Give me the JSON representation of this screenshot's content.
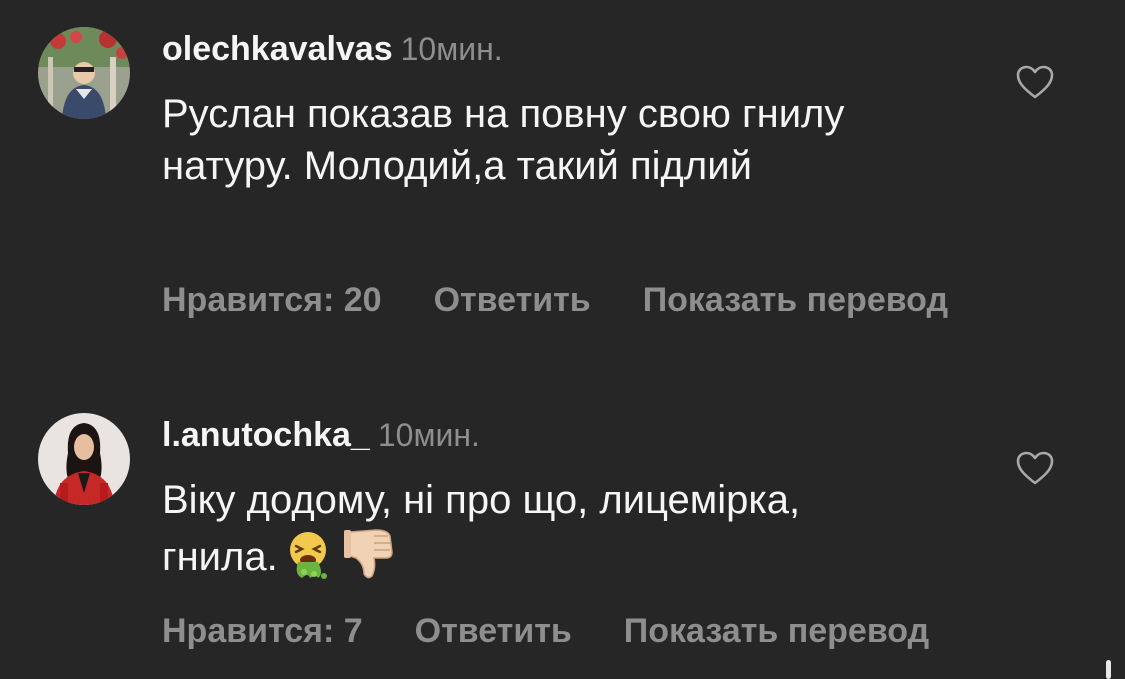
{
  "comments": [
    {
      "username": "olechkavalvas",
      "time": "10мин.",
      "text": "Руслан показав на повну свою гнилу натуру. Молодий,а такий підлий",
      "likes_label": "Нравится: 20",
      "reply_label": "Ответить",
      "translate_label": "Показать перевод",
      "like_icon": "heart-outline-icon"
    },
    {
      "username": "l.anutochka_",
      "time": "10мин.",
      "text": "Віку додому, ні про що, лицемірка, гнила.",
      "likes_label": "Нравится: 7",
      "reply_label": "Ответить",
      "translate_label": "Показать перевод",
      "like_icon": "heart-outline-icon",
      "emojis": [
        "vomiting-face-emoji",
        "thumbs-down-emoji"
      ]
    }
  ],
  "colors": {
    "background": "#262626",
    "primary_text": "#f5f5f5",
    "secondary_text": "#8e8e8e"
  }
}
